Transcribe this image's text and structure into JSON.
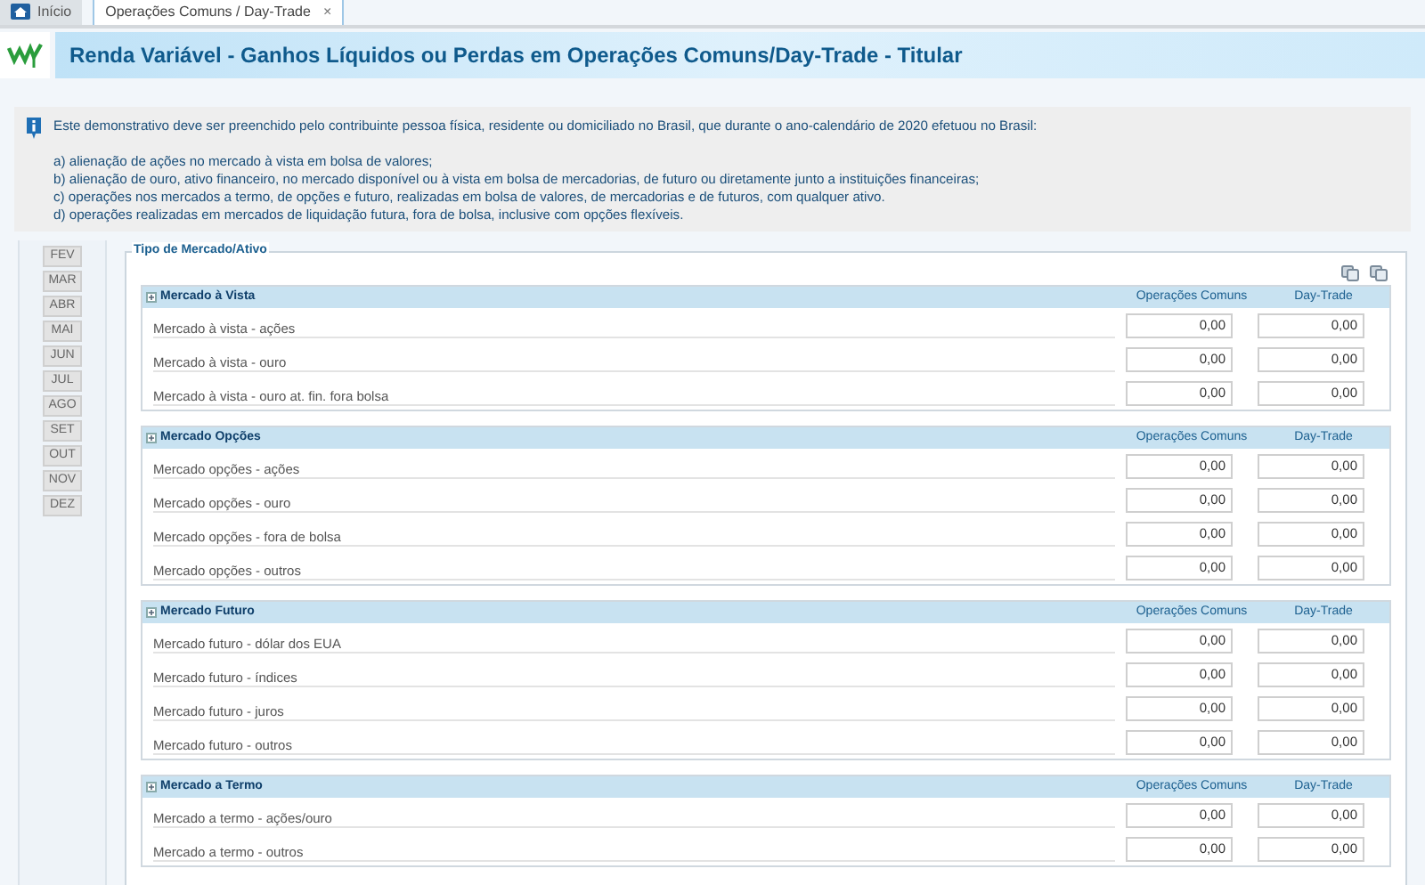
{
  "tabs": [
    {
      "label": "Início",
      "selected": false,
      "kind": "home"
    },
    {
      "label": "Operações Comuns / Day-Trade",
      "selected": true,
      "kind": "doc",
      "close": "×"
    }
  ],
  "header": {
    "title": "Renda Variável - Ganhos Líquidos ou Perdas em Operações Comuns/Day-Trade - Titular"
  },
  "info": {
    "intro": "Este demonstrativo deve ser preenchido pelo contribuinte pessoa física, residente ou domiciliado no Brasil, que durante o ano-calendário de 2020 efetuou no Brasil:",
    "items": [
      "a) alienação de ações no mercado à vista em bolsa de valores;",
      "b) alienação de ouro, ativo financeiro, no mercado disponível ou à vista em bolsa de mercadorias, de futuro ou diretamente junto a instituições financeiras;",
      "c) operações nos mercados a termo, de opções e futuro, realizadas em bolsa de valores, de mercadorias e de futuros, com qualquer ativo.",
      "d) operações realizadas em mercados de liquidação futura, fora de bolsa, inclusive com opções flexíveis."
    ]
  },
  "months": [
    "FEV",
    "MAR",
    "ABR",
    "MAI",
    "JUN",
    "JUL",
    "AGO",
    "SET",
    "OUT",
    "NOV",
    "DEZ"
  ],
  "panel": {
    "legend": "Tipo de Mercado/Ativo",
    "sections": [
      {
        "title": "Mercado à Vista",
        "col_1": "Operações Comuns",
        "col_2": "Day-Trade",
        "rows": [
          {
            "label": "Mercado à vista - ações",
            "comuns": "0,00",
            "day_trade": "0,00"
          },
          {
            "label": "Mercado à vista - ouro",
            "comuns": "0,00",
            "day_trade": "0,00"
          },
          {
            "label": "Mercado à vista - ouro at. fin. fora bolsa",
            "comuns": "0,00",
            "day_trade": "0,00"
          }
        ]
      },
      {
        "title": "Mercado Opções",
        "col_1": "Operações Comuns",
        "col_2": "Day-Trade",
        "rows": [
          {
            "label": "Mercado opções - ações",
            "comuns": "0,00",
            "day_trade": "0,00"
          },
          {
            "label": "Mercado opções - ouro",
            "comuns": "0,00",
            "day_trade": "0,00"
          },
          {
            "label": "Mercado opções - fora de bolsa",
            "comuns": "0,00",
            "day_trade": "0,00"
          },
          {
            "label": "Mercado opções - outros",
            "comuns": "0,00",
            "day_trade": "0,00"
          }
        ]
      },
      {
        "title": "Mercado Futuro",
        "col_1": "Operações Comuns",
        "col_2": "Day-Trade",
        "rows": [
          {
            "label": "Mercado futuro - dólar dos EUA",
            "comuns": "0,00",
            "day_trade": "0,00"
          },
          {
            "label": "Mercado futuro - índices",
            "comuns": "0,00",
            "day_trade": "0,00"
          },
          {
            "label": "Mercado futuro - juros",
            "comuns": "0,00",
            "day_trade": "0,00"
          },
          {
            "label": "Mercado futuro - outros",
            "comuns": "0,00",
            "day_trade": "0,00"
          }
        ]
      },
      {
        "title": "Mercado a Termo",
        "col_1": "Operações Comuns",
        "col_2": "Day-Trade",
        "rows": [
          {
            "label": "Mercado a termo - ações/ouro",
            "comuns": "0,00",
            "day_trade": "0,00"
          },
          {
            "label": "Mercado a termo - outros",
            "comuns": "0,00",
            "day_trade": "0,00"
          }
        ]
      }
    ]
  }
}
